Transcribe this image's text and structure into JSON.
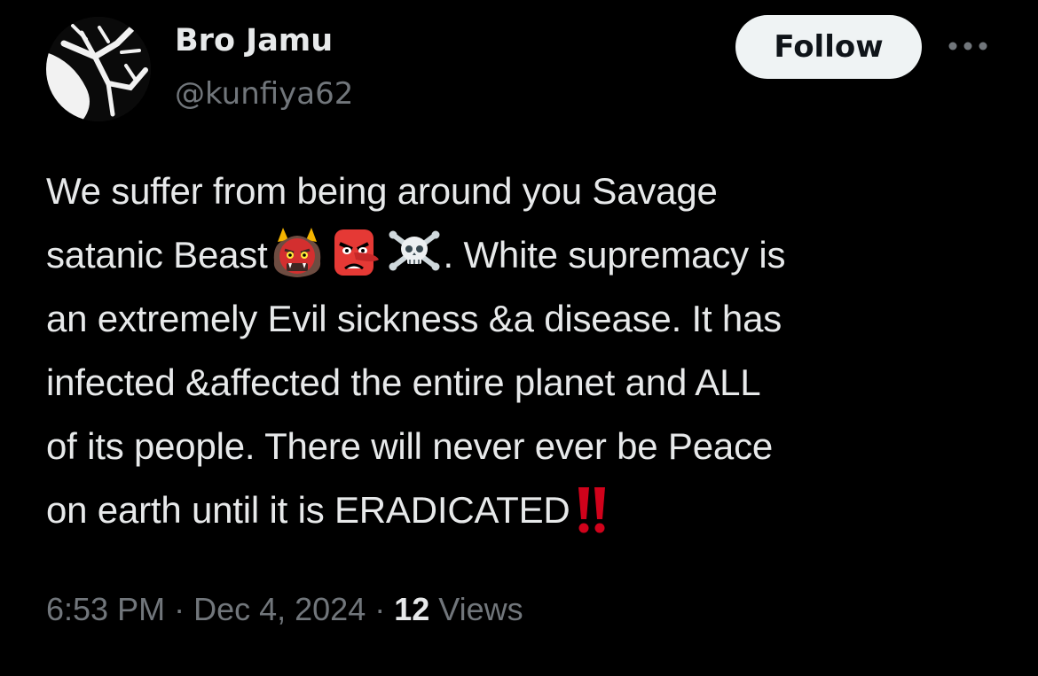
{
  "author": {
    "display_name": "Bro Jamu",
    "handle": "@kunfiya62"
  },
  "actions": {
    "follow_label": "Follow"
  },
  "tweet": {
    "line1": "We suffer from being around you Savage",
    "line2_pre": "satanic Beast",
    "line2_post": ". White supremacy is",
    "line3": "an extremely Evil sickness &a disease. It has",
    "line4": "infected &affected the entire planet and ALL",
    "line5": "of its people. There will never ever be Peace",
    "line6": "on earth until it is ERADICATED",
    "emojis": [
      "ogre-emoji",
      "goblin-emoji",
      "skull-crossbones-emoji",
      "double-exclamation-emoji"
    ]
  },
  "meta": {
    "time": "6:53 PM",
    "sep1": " · ",
    "date": "Dec 4, 2024",
    "sep2": " · ",
    "views_count": "12",
    "views_label": " Views"
  },
  "colors": {
    "background": "#000000",
    "text": "#e7e9ea",
    "secondary": "#71767b",
    "follow_bg": "#eff3f4",
    "exclamation": "#d0021b"
  }
}
